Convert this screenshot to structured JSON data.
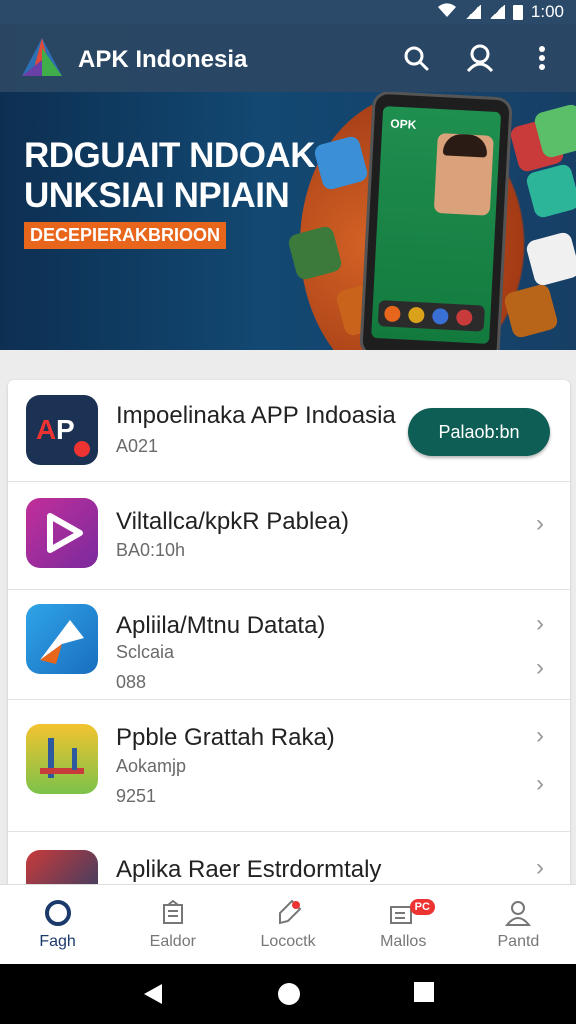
{
  "status": {
    "time": "1:00"
  },
  "app_bar": {
    "title": "APK Indonesia"
  },
  "banner": {
    "line1": "RDGUAIT NDOAK",
    "line2": "UNKSIAI NPIAIN",
    "tag": "DECEPIERAKBRIOON",
    "phone_text": "OPK"
  },
  "apps": [
    {
      "title": "Impoelinaka APP Indoasia",
      "sub1": "A021",
      "button": "Palaob:bn"
    },
    {
      "title": "Viltallca/kpkR Pablea)",
      "sub1": "BA0:10h"
    },
    {
      "title": "Apliila/Mtnu Datata)",
      "sub1": "Sclcaia",
      "sub2": "088"
    },
    {
      "title": "Ppble Grattah Raka)",
      "sub1": "Aokamjp",
      "sub2": "9251"
    },
    {
      "title": "Aplika Raer Estrdormtaly"
    }
  ],
  "bottom_nav": [
    {
      "label": "Fagh",
      "icon": "home-ring-icon",
      "active": true
    },
    {
      "label": "Ealdor",
      "icon": "folder-icon"
    },
    {
      "label": "Lococtk",
      "icon": "tag-icon"
    },
    {
      "label": "Mallos",
      "icon": "mail-icon",
      "badge": "PC"
    },
    {
      "label": "Pantd",
      "icon": "person-icon"
    }
  ],
  "colors": {
    "primary": "#0e5e55",
    "app_bar": "#2b4864",
    "accent": "#e8651c"
  }
}
